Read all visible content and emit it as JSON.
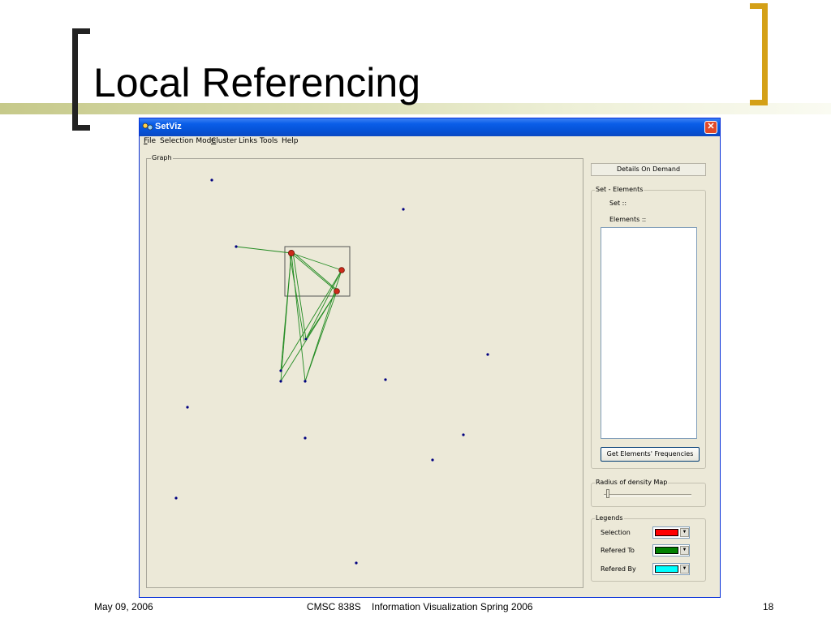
{
  "slide": {
    "title": "Local Referencing",
    "footer_date": "May 09, 2006",
    "footer_course": "CMSC 838S    Information Visualization Spring 2006",
    "footer_page": "18"
  },
  "window": {
    "title": "SetViz",
    "close_glyph": "✕"
  },
  "menu": {
    "items": [
      "File",
      "Selection Mode",
      "Cluster",
      "Links",
      "Tools",
      "Help"
    ]
  },
  "graph": {
    "group_label": "Graph",
    "colors": {
      "node": "#000080",
      "selected": "#cc2a1a",
      "link": "#228b22"
    }
  },
  "details": {
    "button_label": "Details On Demand",
    "set_elements_label": "Set - Elements",
    "set_label": "Set ::",
    "elements_label": "Elements ::",
    "freq_button_label": "Get Elements' Frequencies"
  },
  "density": {
    "label": "Radius of density Map",
    "value": 0.03
  },
  "legends": {
    "label": "Legends",
    "items": [
      {
        "label": "Selection",
        "color": "#ff0000"
      },
      {
        "label": "Refered To",
        "color": "#008000"
      },
      {
        "label": "Refered By",
        "color": "#00ffff"
      }
    ]
  }
}
